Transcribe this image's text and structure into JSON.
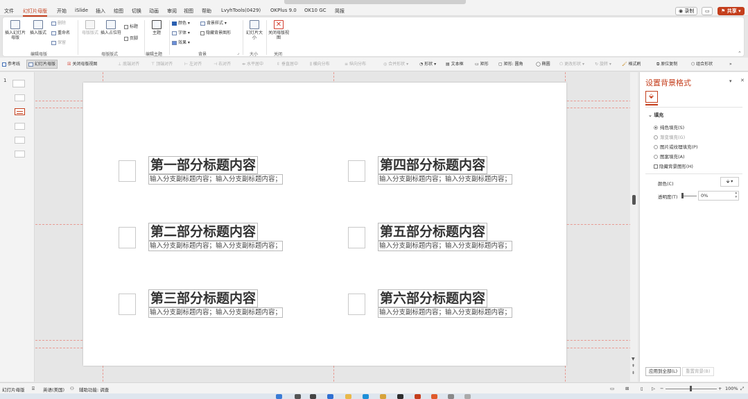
{
  "menubar": {
    "tabs": [
      "文件",
      "幻灯片母版",
      "开始",
      "iSlide",
      "插入",
      "绘图",
      "切换",
      "动画",
      "审阅",
      "视图",
      "帮助",
      "LvyhTools(0429)",
      "OKPlus 9.0",
      "OK10 GC",
      "简报"
    ],
    "active_tab": "幻灯片母版",
    "record_label": "◉ 录制",
    "share_label": "共享",
    "accent": "#c43e1c"
  },
  "ribbon": {
    "insert_master": "插入幻灯片母版",
    "insert_layout": "插入版式",
    "delete": "删除",
    "rename": "重命名",
    "preserve": "保留",
    "group_edit_master": "编辑母版",
    "master_layout": "母版版式",
    "insert_placeholder": "插入占位符",
    "title_chk": "标题",
    "footer_chk": "页脚",
    "group_master_layout": "母版版式",
    "theme": "主题",
    "group_edit_theme": "编辑主题",
    "colors": "颜色",
    "fonts": "字体",
    "effects": "效果",
    "bg_styles": "背景样式",
    "hide_bg": "隐藏背景图形",
    "group_background": "背景",
    "slide_size": "幻灯片大小",
    "group_size": "大小",
    "close_master": "关闭母版视图",
    "group_close": "关闭"
  },
  "toolbar2": {
    "items": [
      "参考线",
      "幻灯片母版",
      "关闭母版视图",
      "底端对齐",
      "顶端对齐",
      "左对齐",
      "右对齐",
      "水平居中",
      "垂直居中",
      "横向分布",
      "纵向分布",
      "合并形状",
      "形状",
      "文本框",
      "矩形",
      "矩形: 圆角",
      "椭圆",
      "更改形状",
      "旋转",
      "格式刷",
      "原位复制",
      "组合形状",
      "»"
    ]
  },
  "thumbs": {
    "slide_number": "1"
  },
  "slide": {
    "sections": [
      {
        "title": "第一部分标题内容",
        "subtitle": "输入分支副标题内容；输入分支副标题内容；"
      },
      {
        "title": "第二部分标题内容",
        "subtitle": "输入分支副标题内容；输入分支副标题内容；"
      },
      {
        "title": "第三部分标题内容",
        "subtitle": "输入分支副标题内容；输入分支副标题内容；"
      },
      {
        "title": "第四部分标题内容",
        "subtitle": "输入分支副标题内容；输入分支副标题内容；"
      },
      {
        "title": "第五部分标题内容",
        "subtitle": "输入分支副标题内容；输入分支副标题内容；"
      },
      {
        "title": "第六部分标题内容",
        "subtitle": "输入分支副标题内容；输入分支副标题内容；"
      }
    ]
  },
  "pane": {
    "title": "设置背景格式",
    "fill_section": "填充",
    "options": [
      {
        "label": "纯色填充(S)",
        "selected": true
      },
      {
        "label": "渐变填充(G)",
        "selected": false
      },
      {
        "label": "图片或纹理填充(P)",
        "selected": false
      },
      {
        "label": "图案填充(A)",
        "selected": false
      }
    ],
    "hide_bg_chk": "隐藏背景图形(H)",
    "color_label": "颜色(C)",
    "transparency_label": "透明度(T)",
    "transparency_value": "0%",
    "apply_all": "应用到全部(L)",
    "reset_bg": "重置背景(B)"
  },
  "statusbar": {
    "view": "幻灯片母版",
    "language": "英语(美国)",
    "accessibility": "辅助功能: 调查",
    "zoom": "100%"
  }
}
